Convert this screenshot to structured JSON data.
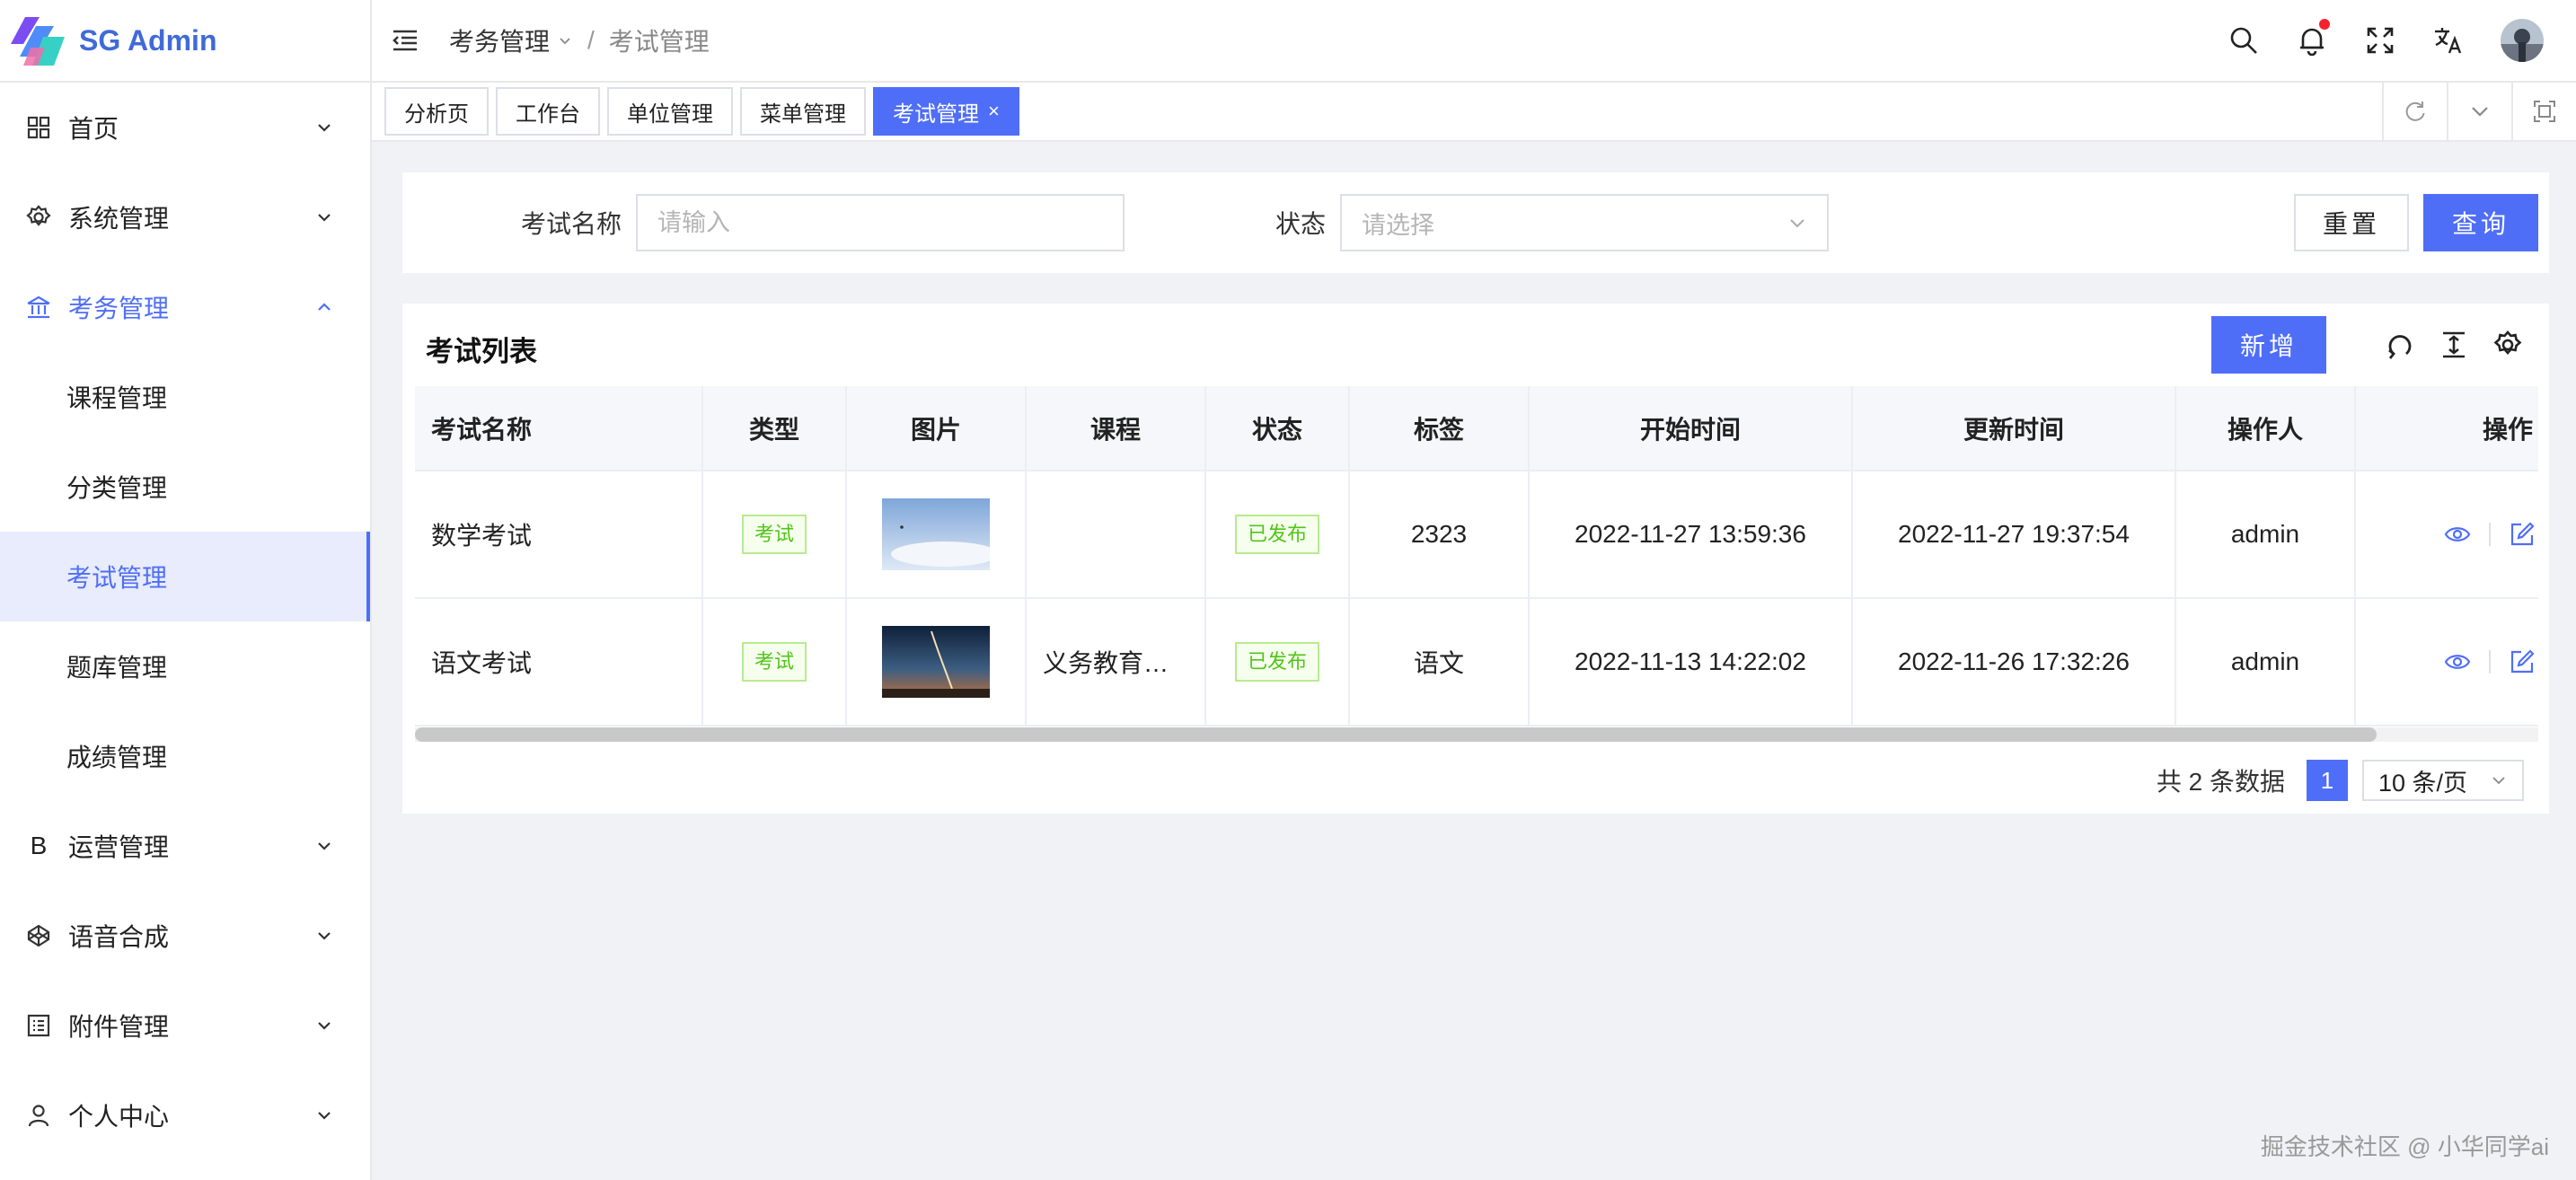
{
  "app": {
    "name": "SG Admin"
  },
  "sidebar": {
    "items": [
      {
        "label": "首页"
      },
      {
        "label": "系统管理"
      },
      {
        "label": "考务管理"
      },
      {
        "label": "运营管理"
      },
      {
        "label": "语音合成"
      },
      {
        "label": "附件管理"
      },
      {
        "label": "个人中心"
      }
    ],
    "submenu": [
      {
        "label": "课程管理"
      },
      {
        "label": "分类管理"
      },
      {
        "label": "考试管理"
      },
      {
        "label": "题库管理"
      },
      {
        "label": "成绩管理"
      }
    ],
    "operations_icon_letter": "B"
  },
  "header": {
    "breadcrumb": {
      "parent": "考务管理",
      "separator": "/",
      "current": "考试管理"
    }
  },
  "tabs": [
    {
      "label": "分析页"
    },
    {
      "label": "工作台"
    },
    {
      "label": "单位管理"
    },
    {
      "label": "菜单管理"
    },
    {
      "label": "考试管理",
      "close": "×"
    }
  ],
  "search": {
    "name_label": "考试名称",
    "name_placeholder": "请输入",
    "status_label": "状态",
    "status_placeholder": "请选择",
    "reset_label": "重置",
    "query_label": "查询"
  },
  "table": {
    "title": "考试列表",
    "add_label": "新增",
    "columns": [
      "考试名称",
      "类型",
      "图片",
      "课程",
      "状态",
      "标签",
      "开始时间",
      "更新时间",
      "操作人",
      "操作"
    ],
    "rows": [
      {
        "name": "数学考试",
        "type": "考试",
        "course": "",
        "status": "已发布",
        "tag": "2323",
        "start": "2022-11-27 13:59:36",
        "updated": "2022-11-27 19:37:54",
        "operator": "admin"
      },
      {
        "name": "语文考试",
        "type": "考试",
        "course": "义务教育语文课程",
        "status": "已发布",
        "tag": "语文",
        "start": "2022-11-13 14:22:02",
        "updated": "2022-11-26 17:32:26",
        "operator": "admin"
      }
    ]
  },
  "pagination": {
    "total": "共 2 条数据",
    "current": "1",
    "page_size": "10 条/页"
  },
  "watermark": "掘金技术社区 @ 小华同学ai",
  "colors": {
    "primary": "#4f6ef7",
    "success": "#52c41a",
    "danger": "#f5222d",
    "logo": "#3f6ad8"
  }
}
